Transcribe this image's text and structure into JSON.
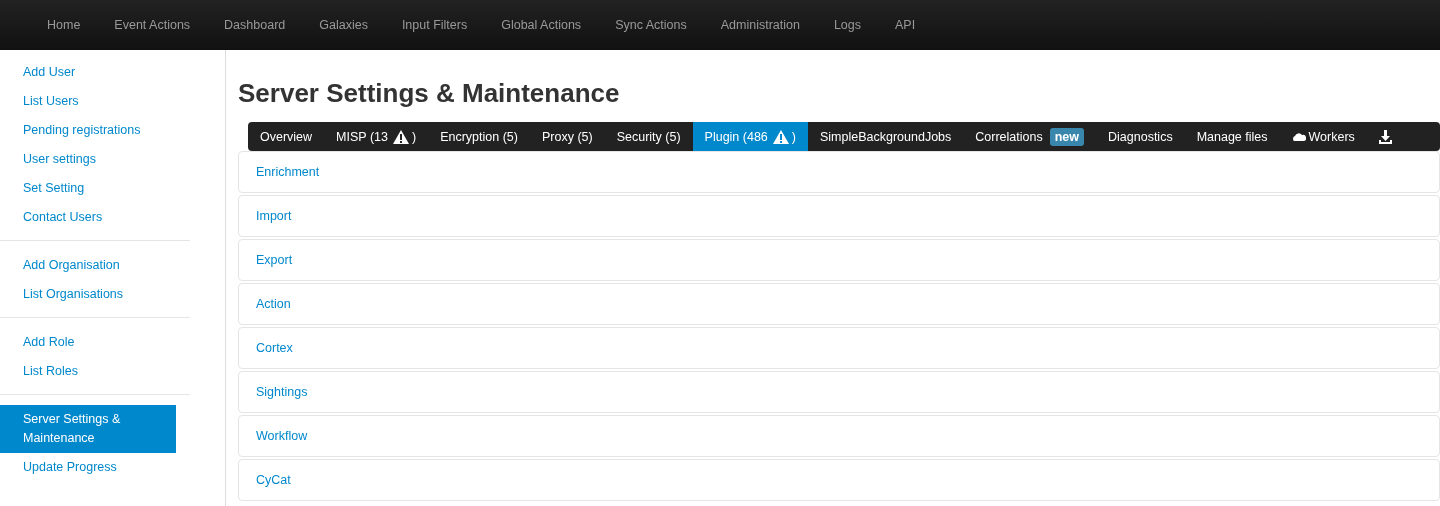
{
  "top_nav": [
    "Home",
    "Event Actions",
    "Dashboard",
    "Galaxies",
    "Input Filters",
    "Global Actions",
    "Sync Actions",
    "Administration",
    "Logs",
    "API"
  ],
  "sidebar": {
    "groups": [
      [
        {
          "label": "Add User",
          "selected": false
        },
        {
          "label": "List Users",
          "selected": false
        },
        {
          "label": "Pending registrations",
          "selected": false
        },
        {
          "label": "User settings",
          "selected": false
        },
        {
          "label": "Set Setting",
          "selected": false
        },
        {
          "label": "Contact Users",
          "selected": false
        }
      ],
      [
        {
          "label": "Add Organisation",
          "selected": false
        },
        {
          "label": "List Organisations",
          "selected": false
        }
      ],
      [
        {
          "label": "Add Role",
          "selected": false
        },
        {
          "label": "List Roles",
          "selected": false
        }
      ],
      [
        {
          "label": "Server Settings & Maintenance",
          "selected": true
        },
        {
          "label": "Update Progress",
          "selected": false
        }
      ]
    ]
  },
  "page_title": "Server Settings & Maintenance",
  "tabs": [
    {
      "label": "Overview",
      "selected": false
    },
    {
      "label": "MISP (13",
      "warning": true,
      "after": ")",
      "selected": false
    },
    {
      "label": "Encryption (5)",
      "selected": false
    },
    {
      "label": "Proxy (5)",
      "selected": false
    },
    {
      "label": "Security (5)",
      "selected": false
    },
    {
      "label": "Plugin (486",
      "warning": true,
      "after": ")",
      "selected": true
    },
    {
      "label": "SimpleBackgroundJobs",
      "selected": false
    },
    {
      "label": "Correlations",
      "badge": "new",
      "selected": false
    },
    {
      "label": "Diagnostics",
      "selected": false
    },
    {
      "label": "Manage files",
      "selected": false
    },
    {
      "label": "Workers",
      "kind": "cloud",
      "selected": false
    },
    {
      "kind": "download",
      "selected": false
    }
  ],
  "sections": [
    "Enrichment",
    "Import",
    "Export",
    "Action",
    "Cortex",
    "Sightings",
    "Workflow",
    "CyCat"
  ]
}
